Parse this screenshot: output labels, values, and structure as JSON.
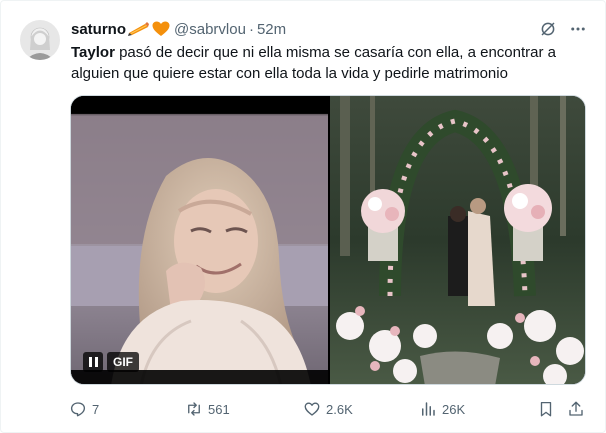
{
  "tweet": {
    "display_name": "saturno",
    "name_emojis": [
      "pencil-icon",
      "orange-heart-icon"
    ],
    "handle": "@sabrvlou",
    "separator": "·",
    "time": "52m",
    "text_bold": "Taylor",
    "text_rest": " pasó de decir que ni ella misma se casaría con ella, a encontrar a alguien que quiere estar con ella toda la vida y pedirle matrimonio"
  },
  "media": {
    "left": {
      "type": "gif",
      "badge": "GIF",
      "state": "paused-control-visible"
    },
    "right": {
      "type": "photo"
    }
  },
  "actions": {
    "replies": "7",
    "reposts": "561",
    "likes": "2.6K",
    "views": "26K"
  },
  "colors": {
    "text_primary": "#0f1419",
    "text_secondary": "#536471",
    "border": "#cfd9de",
    "heart_orange": "#f4900c",
    "pencil_orange": "#f4900c"
  },
  "icons": [
    "grok-icon",
    "more-icon",
    "reply-icon",
    "repost-icon",
    "like-icon",
    "views-icon",
    "bookmark-icon",
    "share-icon"
  ]
}
